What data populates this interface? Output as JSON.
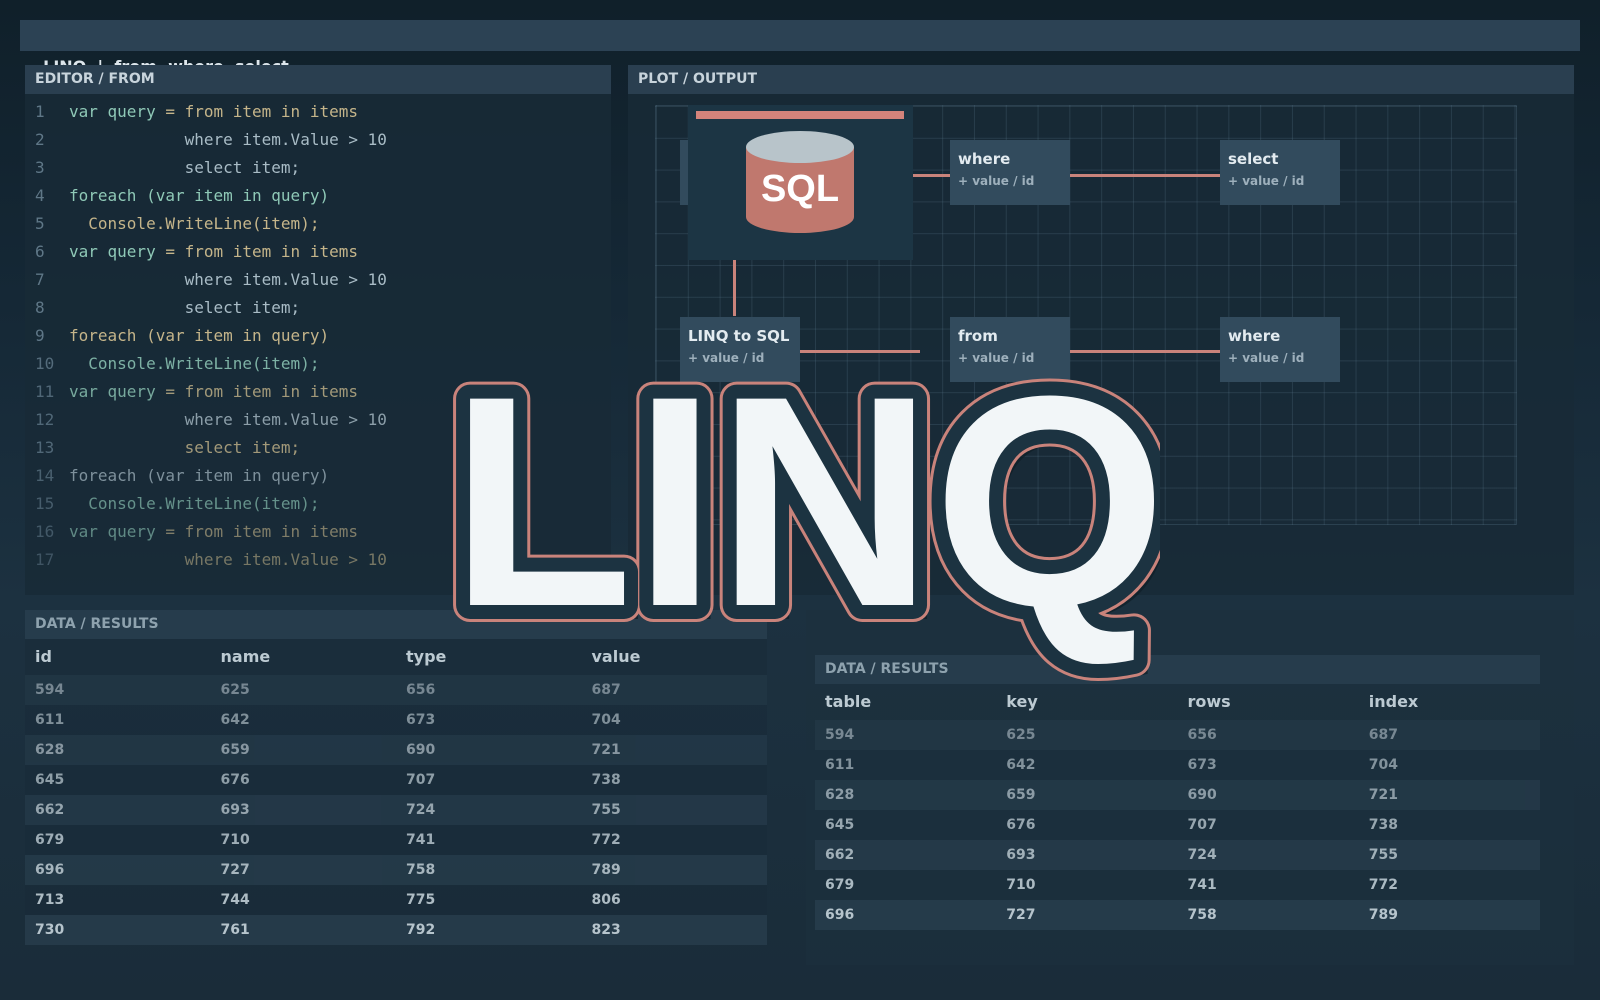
{
  "window": {
    "title": "LINQ  |  from  where  select"
  },
  "editor": {
    "title": "EDITOR / FROM",
    "lines": [
      {
        "n": "1",
        "a": "var query ",
        "b": "= from item in items",
        "c": ""
      },
      {
        "n": "2",
        "a": "",
        "b": "",
        "c": "            where item.Value > 10"
      },
      {
        "n": "3",
        "a": "",
        "b": "",
        "c": "            select item;"
      },
      {
        "n": "4",
        "a": "foreach (var item in query)",
        "b": "",
        "c": ""
      },
      {
        "n": "5",
        "a": "",
        "b": "  Console.WriteLine(item);",
        "c": ""
      },
      {
        "n": "6",
        "a": "var query ",
        "b": "= from item in items",
        "c": ""
      },
      {
        "n": "7",
        "a": "",
        "b": "",
        "c": "            where item.Value > 10"
      },
      {
        "n": "8",
        "a": "",
        "b": "",
        "c": "            select item;"
      },
      {
        "n": "9",
        "a": "",
        "b": "foreach (var item in query)",
        "c": ""
      },
      {
        "n": "10",
        "a": "  Console.WriteLine(item);",
        "b": "",
        "c": ""
      },
      {
        "n": "11",
        "a": "var query ",
        "b": "= from item in items",
        "c": ""
      },
      {
        "n": "12",
        "a": "",
        "b": "",
        "c": "            where item.Value > 10"
      },
      {
        "n": "13",
        "a": "",
        "b": "            select item;",
        "c": ""
      },
      {
        "n": "14",
        "a": "",
        "b": "",
        "c": "foreach (var item in query)"
      },
      {
        "n": "15",
        "a": "  Console.WriteLine(item);",
        "b": "",
        "c": ""
      },
      {
        "n": "16",
        "a": "var query ",
        "b": "= from item in items",
        "c": ""
      },
      {
        "n": "17",
        "a": "",
        "b": "            where item.Value > 10",
        "c": ""
      }
    ]
  },
  "plot": {
    "title": "PLOT / OUTPUT",
    "node_sub": "+ value / id",
    "nodes": [
      {
        "label": "where"
      },
      {
        "label": "select"
      },
      {
        "label": "LINQ to SQL"
      },
      {
        "label": "from"
      },
      {
        "label": "where"
      }
    ],
    "sql_label": "SQL"
  },
  "results1": {
    "title": "DATA / RESULTS",
    "columns": [
      "id",
      "name",
      "type",
      "value"
    ],
    "rows": [
      [
        "594",
        "625",
        "656",
        "687"
      ],
      [
        "611",
        "642",
        "673",
        "704"
      ],
      [
        "628",
        "659",
        "690",
        "721"
      ],
      [
        "645",
        "676",
        "707",
        "738"
      ],
      [
        "662",
        "693",
        "724",
        "755"
      ],
      [
        "679",
        "710",
        "741",
        "772"
      ],
      [
        "696",
        "727",
        "758",
        "789"
      ],
      [
        "713",
        "744",
        "775",
        "806"
      ],
      [
        "730",
        "761",
        "792",
        "823"
      ]
    ]
  },
  "results2": {
    "title": "DATA / RESULTS",
    "columns": [
      "table",
      "key",
      "rows",
      "index"
    ],
    "rows": [
      [
        "594",
        "625",
        "656",
        "687"
      ],
      [
        "611",
        "642",
        "673",
        "704"
      ],
      [
        "628",
        "659",
        "690",
        "721"
      ],
      [
        "645",
        "676",
        "707",
        "738"
      ],
      [
        "662",
        "693",
        "724",
        "755"
      ],
      [
        "679",
        "710",
        "741",
        "772"
      ],
      [
        "696",
        "727",
        "758",
        "789"
      ]
    ]
  },
  "logo": {
    "text": "LINQ"
  },
  "colors": {
    "accent": "#c9837b",
    "logo_fill": "#f2f6f8",
    "logo_stroke": "#1c3341",
    "sql_drum": "#c0786e"
  }
}
